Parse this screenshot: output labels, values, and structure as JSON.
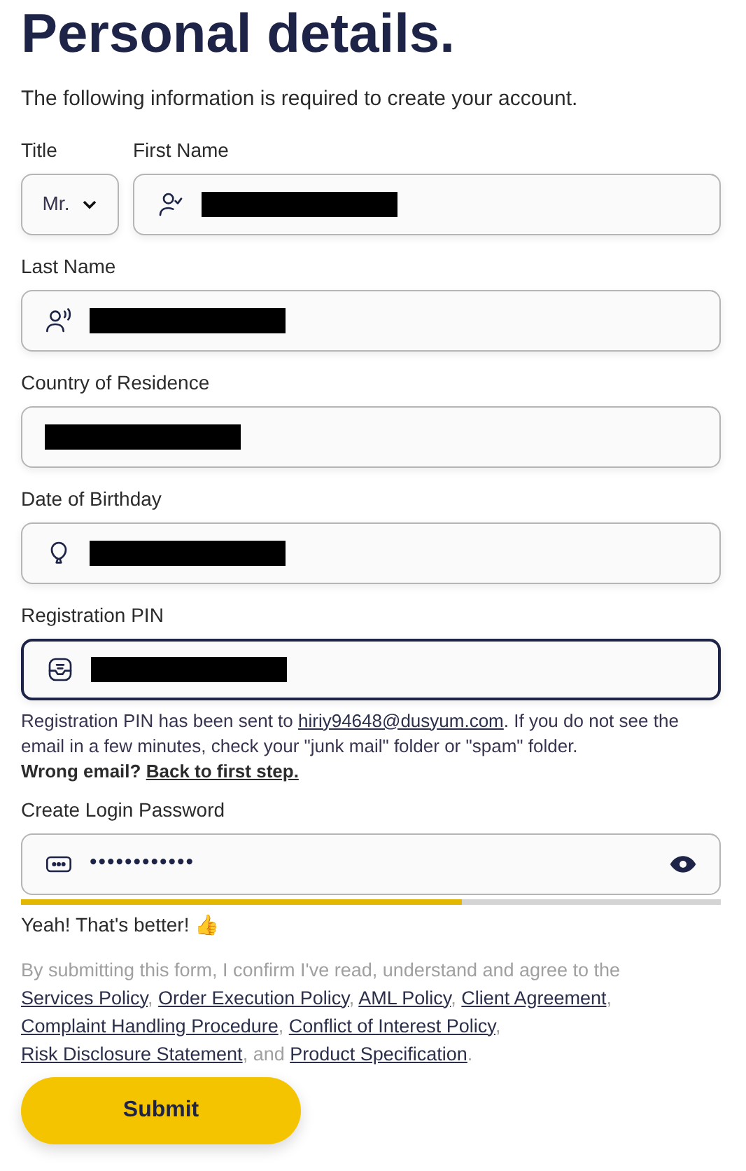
{
  "heading": "Personal details.",
  "subtitle": "The following information is required to create your account.",
  "title_select": {
    "label": "Title",
    "value": "Mr."
  },
  "fields": [
    {
      "label": "First Name",
      "redacted": true,
      "focused": false
    },
    {
      "label": "Last Name",
      "redacted": true,
      "focused": false
    },
    {
      "label": "Country of Residence",
      "redacted": true,
      "focused": false
    },
    {
      "label": "Date of Birthday",
      "redacted": true,
      "focused": false
    },
    {
      "label": "Registration PIN",
      "redacted": true,
      "focused": true
    }
  ],
  "pin_note": [
    {
      "kind": "text",
      "text": "Registration PIN has been sent to "
    },
    {
      "kind": "link",
      "text": "hiriy94648@dusyum.com"
    },
    {
      "kind": "text",
      "text": ". If you do not see the email in a few minutes, check your \"junk mail\" folder or \"spam\" folder."
    }
  ],
  "wrong_email": {
    "text": "Wrong email?",
    "link": "Back to first step."
  },
  "password": {
    "label": "Create Login Password",
    "value": "••••••••••••",
    "level": 0.63,
    "feedback": "Yeah! That's better! 👍"
  },
  "consent": [
    {
      "kind": "text",
      "text": "By submitting this form, I confirm I've read, understand and agree to the "
    },
    {
      "kind": "link",
      "text": "Services Policy"
    },
    {
      "kind": "text",
      "text": ", "
    },
    {
      "kind": "link",
      "text": "Order Execution Policy"
    },
    {
      "kind": "text",
      "text": ", "
    },
    {
      "kind": "link",
      "text": "AML Policy"
    },
    {
      "kind": "text",
      "text": ", "
    },
    {
      "kind": "link",
      "text": "Client Agreement"
    },
    {
      "kind": "text",
      "text": ", "
    },
    {
      "kind": "link",
      "text": "Complaint Handling Procedure"
    },
    {
      "kind": "text",
      "text": ", "
    },
    {
      "kind": "link",
      "text": "Conflict of Interest Policy"
    },
    {
      "kind": "text",
      "text": ", "
    },
    {
      "kind": "link",
      "text": "Risk Disclosure Statement"
    },
    {
      "kind": "text",
      "text": ", and "
    },
    {
      "kind": "link",
      "text": "Product Specification"
    },
    {
      "kind": "text",
      "text": "."
    }
  ],
  "submit": "Submit"
}
